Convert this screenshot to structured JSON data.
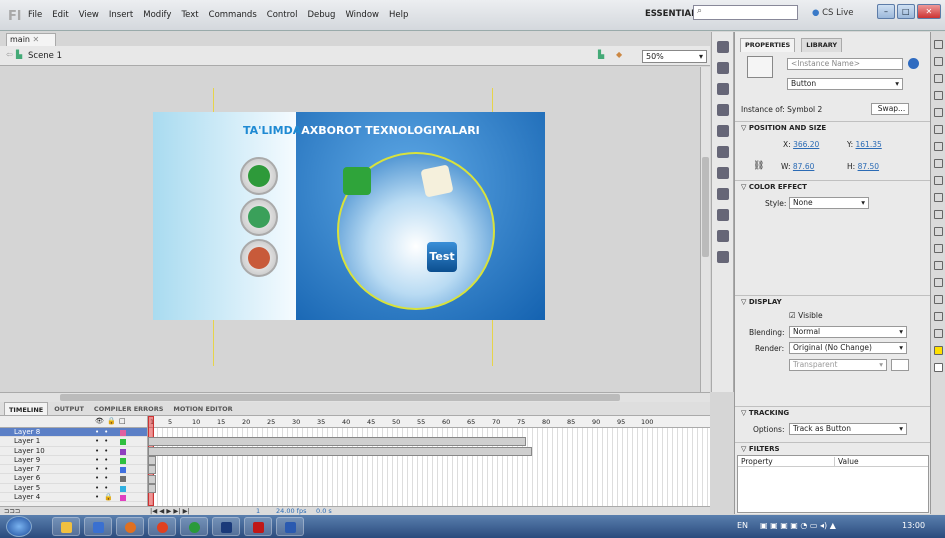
{
  "app": {
    "logo": "Fl",
    "menus": [
      "File",
      "Edit",
      "View",
      "Insert",
      "Modify",
      "Text",
      "Commands",
      "Control",
      "Debug",
      "Window",
      "Help"
    ],
    "workspace": "ESSENTIALS ▾",
    "search_placeholder": "",
    "cslive": "CS Live"
  },
  "document": {
    "tab": "main",
    "scene": "Scene 1",
    "zoom": "50%"
  },
  "stage": {
    "title_part1": "TA'LIMDA",
    "title_part2": "AXBOROT TEXNOLOGIYALARI",
    "test_label": "Test"
  },
  "properties": {
    "tabs": [
      "PROPERTIES",
      "LIBRARY"
    ],
    "instance_name_placeholder": "<Instance Name>",
    "type": "Button",
    "instance_of_label": "Instance of:",
    "instance_of": "Symbol 2",
    "swap": "Swap...",
    "pos_header": "POSITION AND SIZE",
    "x_label": "X:",
    "x": "366.20",
    "y_label": "Y:",
    "y": "161.35",
    "w_label": "W:",
    "w": "87.60",
    "h_label": "H:",
    "h": "87.50",
    "color_header": "COLOR EFFECT",
    "style_label": "Style:",
    "style": "None",
    "display_header": "DISPLAY",
    "visible": "Visible",
    "blending_label": "Blending:",
    "blending": "Normal",
    "render_label": "Render:",
    "render": "Original (No Change)",
    "transparent": "Transparent",
    "tracking_header": "TRACKING",
    "options_label": "Options:",
    "options": "Track as Button",
    "filters_header": "FILTERS",
    "col_property": "Property",
    "col_value": "Value"
  },
  "timeline": {
    "tabs": [
      "TIMELINE",
      "OUTPUT",
      "COMPILER ERRORS",
      "MOTION EDITOR"
    ],
    "layers": [
      "Layer 8",
      "Layer 1",
      "Layer 10",
      "Layer 9",
      "Layer 7",
      "Layer 6",
      "Layer 5",
      "Layer 4"
    ],
    "ruler": [
      "1",
      "5",
      "10",
      "15",
      "20",
      "25",
      "30",
      "35",
      "40",
      "45",
      "50",
      "55",
      "60",
      "65",
      "70",
      "75",
      "80",
      "85",
      "90",
      "95",
      "100"
    ],
    "fps": "24.00 fps",
    "time": "0.0 s",
    "frame": "1"
  },
  "taskbar": {
    "lang": "EN",
    "clock": "13:00"
  }
}
